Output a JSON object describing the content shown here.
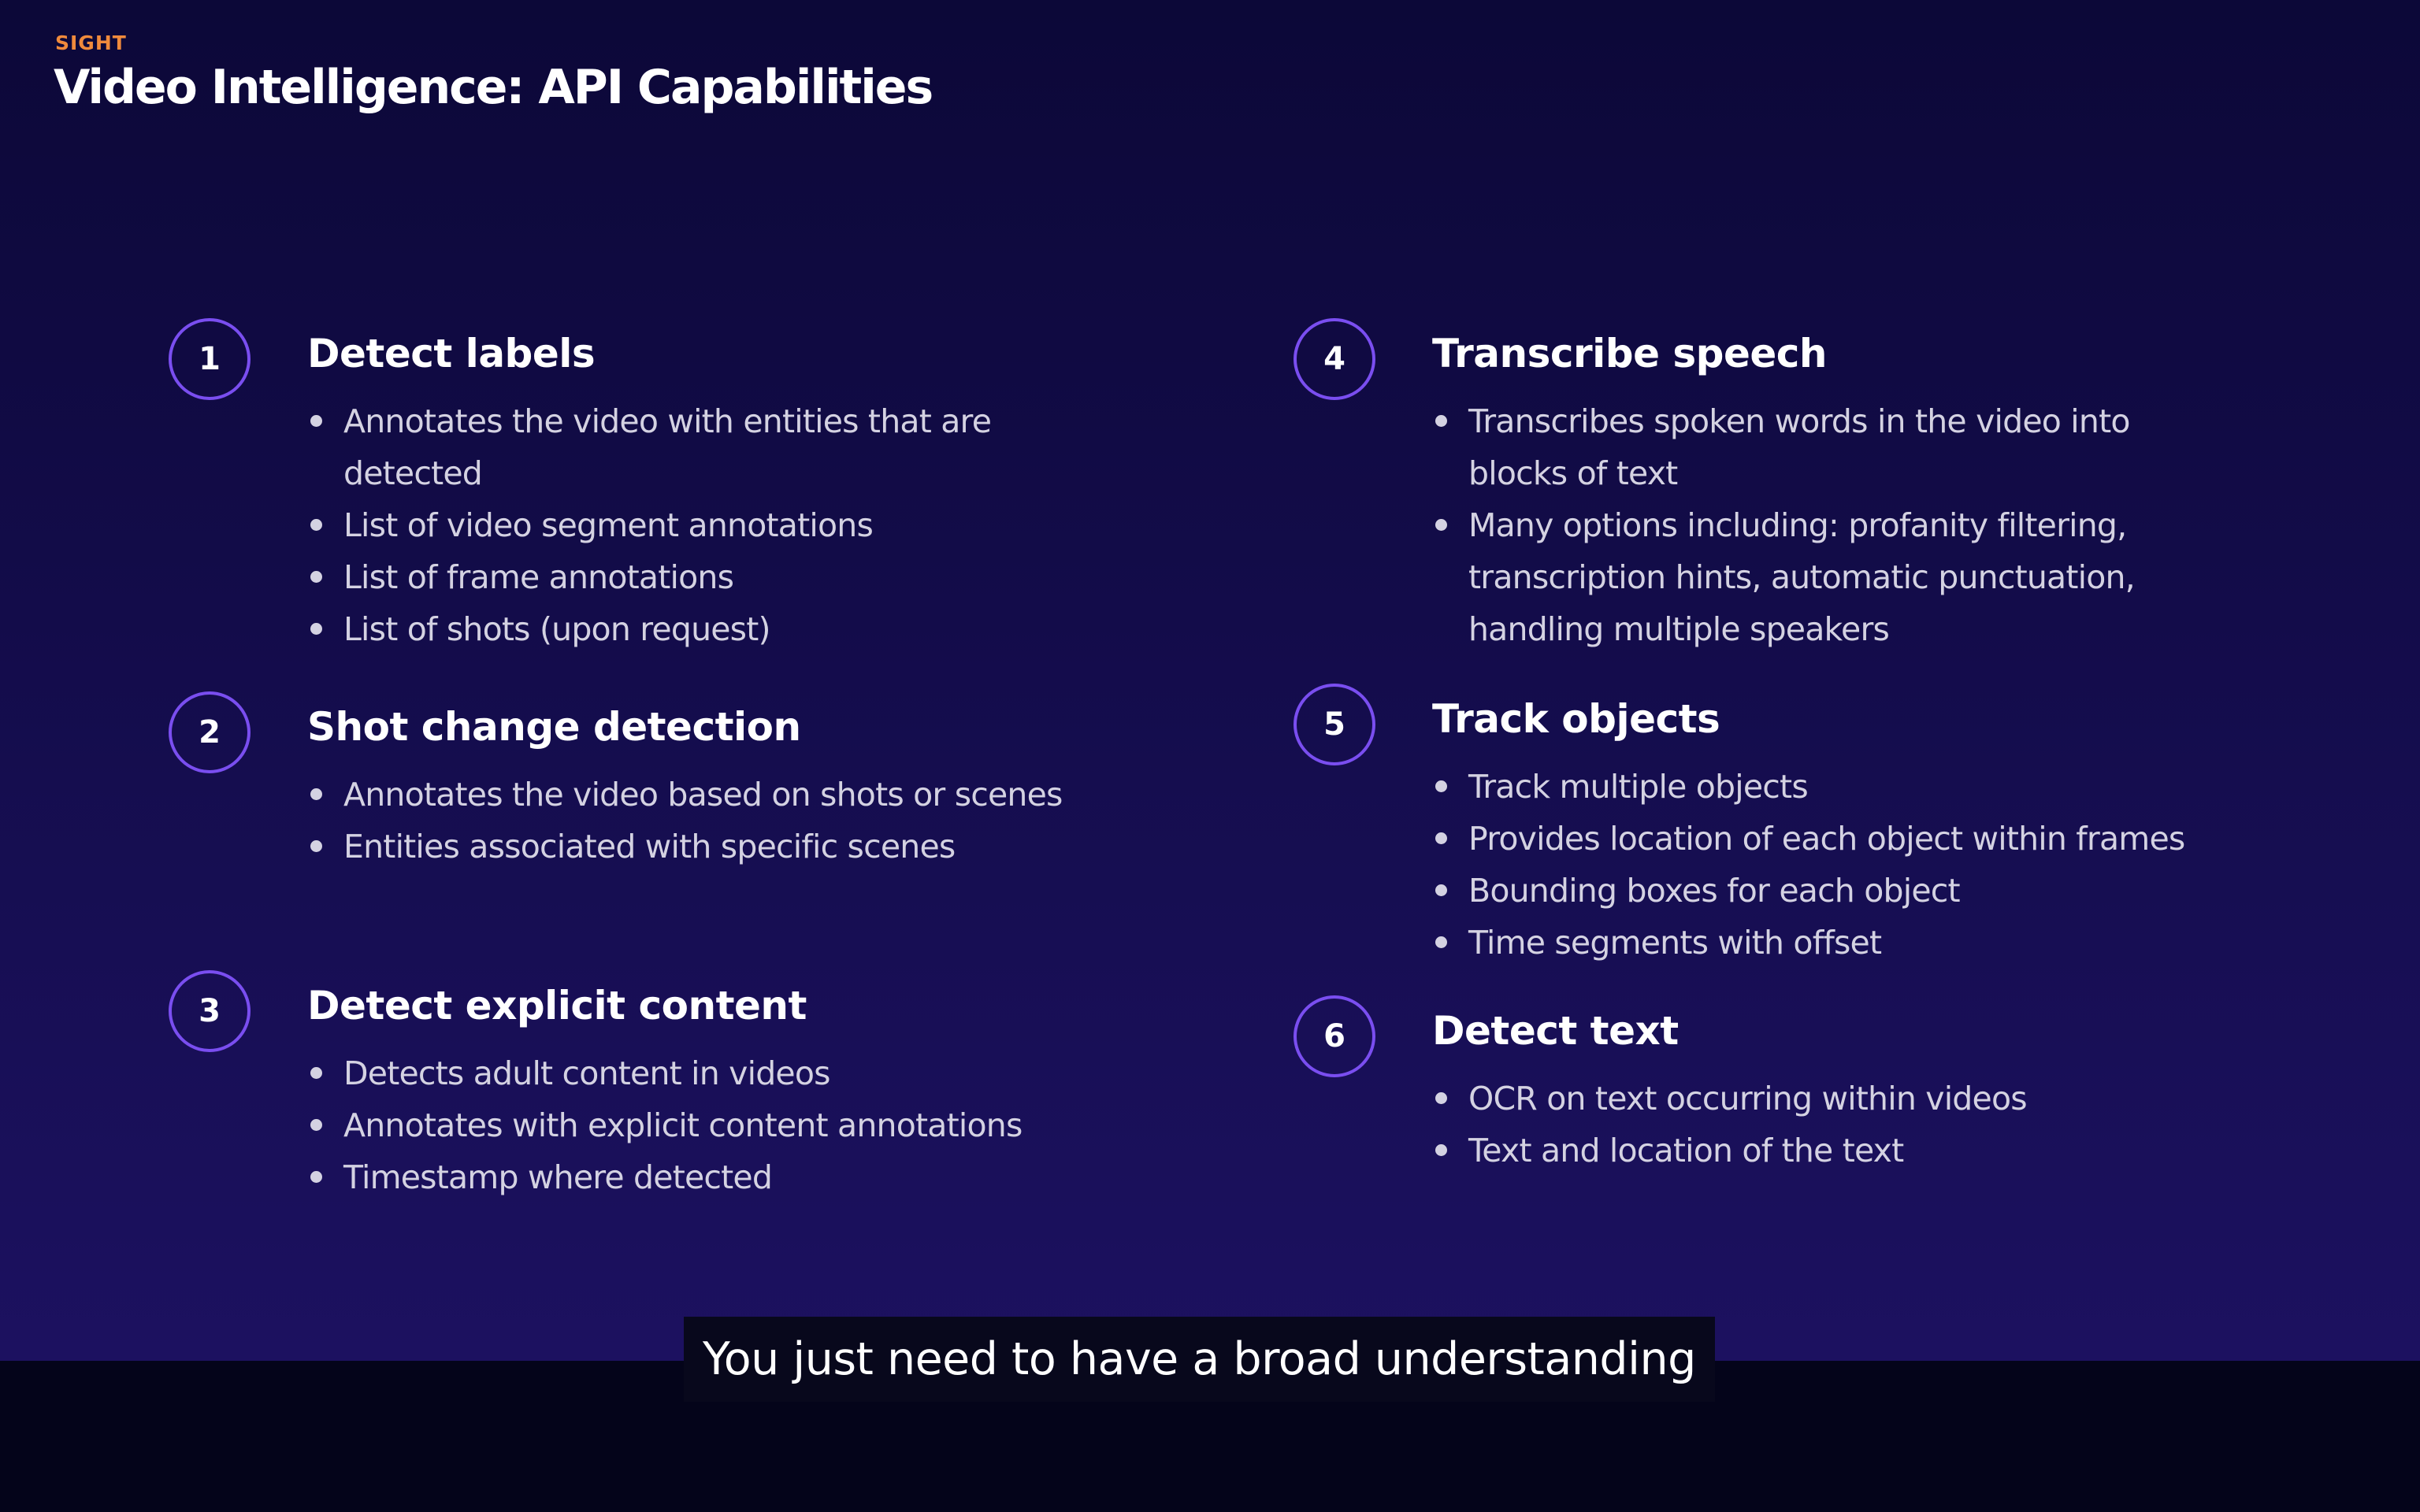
{
  "header": {
    "eyebrow": "SIGHT",
    "title": "Video Intelligence: API Capabilities"
  },
  "capabilities": [
    {
      "number": "1",
      "title": "Detect labels",
      "bullets": [
        "Annotates the video with entities that are detected",
        "List of video segment annotations",
        "List of frame annotations",
        "List of shots (upon request)"
      ]
    },
    {
      "number": "2",
      "title": "Shot change detection",
      "bullets": [
        "Annotates the video based on shots or scenes",
        "Entities associated with specific scenes"
      ]
    },
    {
      "number": "3",
      "title": "Detect explicit content",
      "bullets": [
        "Detects adult content in videos",
        "Annotates with explicit content annotations",
        "Timestamp where detected"
      ]
    },
    {
      "number": "4",
      "title": "Transcribe speech",
      "bullets": [
        "Transcribes spoken words in the video into blocks of text",
        "Many options including: profanity filtering, transcription hints, automatic punctuation, handling multiple speakers"
      ]
    },
    {
      "number": "5",
      "title": "Track objects",
      "bullets": [
        "Track multiple objects",
        "Provides location of each object within frames",
        "Bounding boxes for each object",
        "Time segments with offset"
      ]
    },
    {
      "number": "6",
      "title": "Detect text",
      "bullets": [
        "OCR on text occurring within videos",
        "Text and location of the text"
      ]
    }
  ],
  "caption": {
    "text": "You just need to have a broad understanding"
  },
  "colors": {
    "accent": "#7a4ef0",
    "eyebrow": "#f08a3c",
    "background": "#130c4a"
  }
}
